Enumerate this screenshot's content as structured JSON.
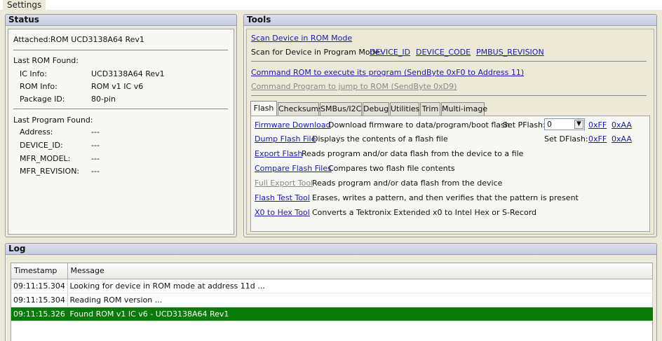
{
  "settings_tab": "Settings",
  "status": {
    "title": "Status",
    "attached_label": "Attached:",
    "attached_value": "ROM UCD3138A64 Rev1",
    "last_rom_title": "Last ROM Found:",
    "ic_info_label": "IC Info:",
    "ic_info_value": "UCD3138A64 Rev1",
    "rom_info_label": "ROM Info:",
    "rom_info_value": "ROM v1 IC v6",
    "package_label": "Package ID:",
    "package_value": "80-pin",
    "last_prog_title": "Last Program Found:",
    "address_label": "Address:",
    "address_value": "---",
    "device_id_label": "DEVICE_ID:",
    "device_id_value": "---",
    "mfr_model_label": "MFR_MODEL:",
    "mfr_model_value": "---",
    "mfr_revision_label": "MFR_REVISION:",
    "mfr_revision_value": "---"
  },
  "tools": {
    "title": "Tools",
    "scan_rom": "Scan Device in ROM Mode",
    "scan_program_label": "Scan for Device in Program Mode:",
    "device_id": "DEVICE_ID",
    "device_code": "DEVICE_CODE",
    "pmbus_revision": "PMBUS_REVISION",
    "cmd_rom": "Command ROM to execute its program (SendByte 0xF0 to Address 11)",
    "cmd_program": "Command Program to jump to ROM (SendByte 0xD9)",
    "tabs": [
      "Flash",
      "Checksums",
      "SMBus/I2C",
      "Debug",
      "Utilities",
      "Trim",
      "Multi-image"
    ],
    "flash": {
      "rows": [
        {
          "link": "Firmware Download",
          "desc": "Download firmware to data/program/boot flash"
        },
        {
          "link": "Dump Flash File",
          "desc": "Displays the contents of a flash file"
        },
        {
          "link": "Export Flash",
          "desc": "Reads program and/or data flash from the device to a file"
        },
        {
          "link": "Compare Flash Files",
          "desc": "Compares two flash file contents"
        },
        {
          "link": "Full Export Tool",
          "desc": "Reads program and/or data flash from the device"
        },
        {
          "link": "Flash Test Tool",
          "desc": "Erases, writes a pattern, and then verifies that the pattern is present"
        },
        {
          "link": "X0 to Hex Tool",
          "desc": "Converts a Tektronix Extended x0 to Intel Hex or S-Record"
        }
      ],
      "set_pflash_label": "Set PFlash:",
      "set_pflash_value": "0",
      "set_dflash_label": "Set DFlash:",
      "ff": "0xFF",
      "aa": "0xAA"
    }
  },
  "log": {
    "title": "Log",
    "columns": [
      "Timestamp",
      "Message"
    ],
    "rows": [
      {
        "time": "09:11:15.304",
        "msg": "Looking for device in ROM mode at address 11d ..."
      },
      {
        "time": "09:11:15.304",
        "msg": "Reading ROM version ..."
      },
      {
        "time": "09:11:15.326",
        "msg": "Found ROM v1 IC v6 - UCD3138A64 Rev1"
      }
    ]
  }
}
